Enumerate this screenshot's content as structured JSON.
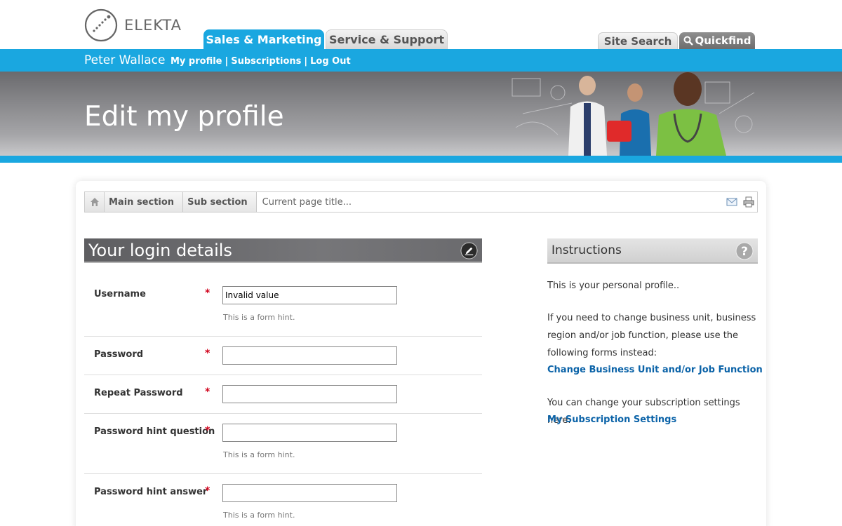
{
  "header": {
    "logo_text": "ELEKTA",
    "tabs": [
      {
        "label": "Sales & Marketing",
        "active": true
      },
      {
        "label": "Service & Support",
        "active": false
      }
    ],
    "site_search_label": "Site Search",
    "quickfind_label": "Quickfind"
  },
  "userbar": {
    "username": "Peter Wallace",
    "links": [
      "My profile",
      "Subscriptions",
      "Log Out"
    ],
    "separator": "|"
  },
  "banner": {
    "title": "Edit my profile"
  },
  "breadcrumb": {
    "items": [
      "Main section",
      "Sub section"
    ],
    "current": "Current page title..."
  },
  "login": {
    "title": "Your login details",
    "required_mark": "*",
    "fields": [
      {
        "label": "Username",
        "value": "Invalid value",
        "hint": "This is a form hint."
      },
      {
        "label": "Password",
        "value": "",
        "hint": ""
      },
      {
        "label": "Repeat Password",
        "value": "",
        "hint": ""
      },
      {
        "label": "Password hint question",
        "value": "",
        "hint": "This is a form hint."
      },
      {
        "label": "Password hint answer",
        "value": "",
        "hint": "This is a form hint."
      }
    ]
  },
  "instructions": {
    "title": "Instructions",
    "p1": "This is your personal profile..",
    "p2": "If you need to change business unit, business region and/or job function, please use the following forms instead:",
    "link1": "Change Business Unit and/or Job Function",
    "p3": "You can change your subscription settings here:",
    "link2": "My Subscription Settings"
  },
  "colors": {
    "brand_blue": "#1aa7e0",
    "link_blue": "#0b63a8",
    "required_red": "#d0021b"
  }
}
